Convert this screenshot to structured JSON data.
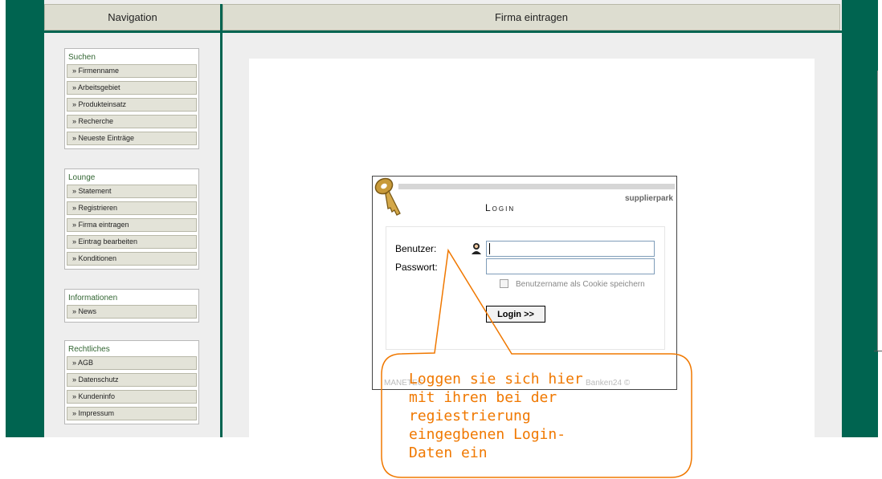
{
  "header": {
    "nav_title": "Navigation",
    "main_title": "Firma eintragen"
  },
  "sidebar": [
    {
      "caption": "Suchen",
      "items": [
        "» Firmenname",
        "» Arbeitsgebiet",
        "» Produkteinsatz",
        "» Recherche",
        "» Neueste Einträge"
      ]
    },
    {
      "caption": "Lounge",
      "items": [
        "» Statement",
        "» Registrieren",
        "» Firma eintragen",
        "» Eintrag bearbeiten",
        "» Konditionen"
      ]
    },
    {
      "caption": "Informationen",
      "items": [
        "» News"
      ]
    },
    {
      "caption": "Rechtliches",
      "items": [
        "» AGB",
        "» Datenschutz",
        "» Kundeninfo",
        "» Impressum"
      ]
    }
  ],
  "login": {
    "brand": "supplierpark",
    "title": "Login",
    "user_label": "Benutzer:",
    "pass_label": "Passwort:",
    "user_value": "",
    "pass_value": "",
    "cookie_label": "Benutzername als Cookie speichern",
    "cookie_checked": false,
    "button_label": "Login >>",
    "footer_left": "MANETEC",
    "footer_right": "Banken24 ©"
  },
  "annotation": {
    "text": "Loggen sie sich hier\nmit ihren bei der\nregiestrierung\neingegbenen Login-\nDaten ein",
    "color": "#f07800"
  },
  "colors": {
    "band": "#006450",
    "frame": "#eeeeee",
    "header": "#ddddd0"
  },
  "icons": {
    "key": "key-icon",
    "user": "user-icon"
  }
}
